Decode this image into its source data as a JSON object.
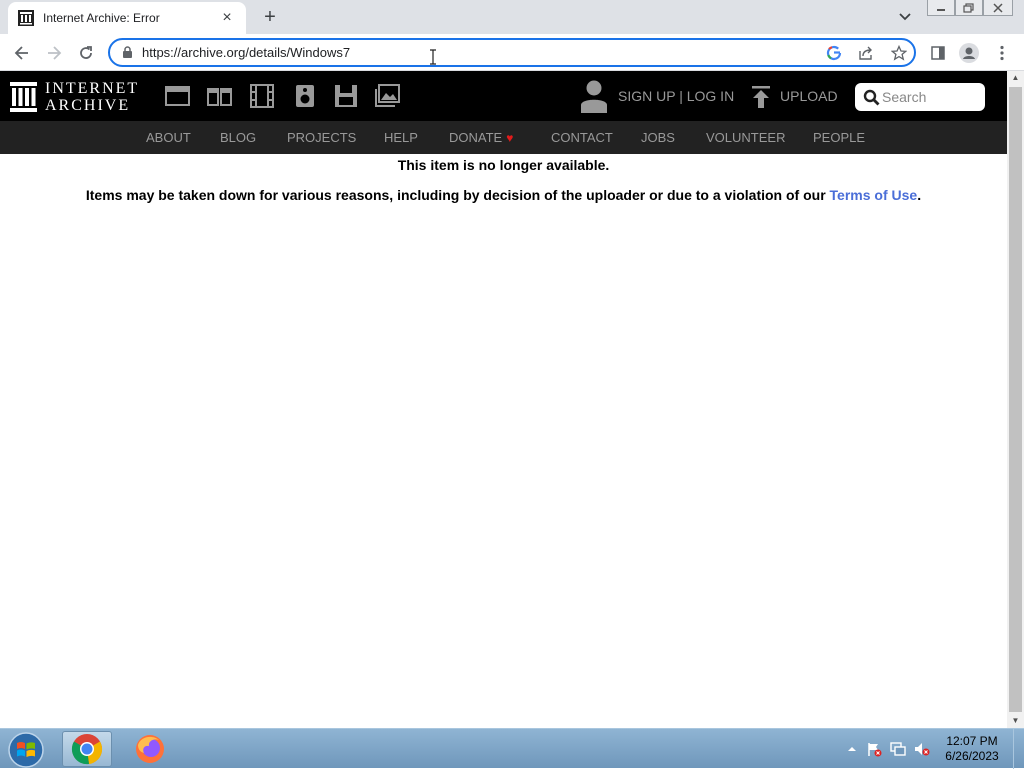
{
  "browser": {
    "tab_title": "Internet Archive: Error",
    "new_tab_symbol": "+",
    "close_symbol": "×",
    "url": "https://archive.org/details/Windows7"
  },
  "ia": {
    "logo_line1": "INTERNET",
    "logo_line2": "ARCHIVE",
    "media_icons": [
      "web-icon",
      "texts-icon",
      "video-icon",
      "audio-icon",
      "software-icon",
      "images-icon"
    ],
    "signup": "SIGN UP | LOG IN",
    "upload": "UPLOAD",
    "search_placeholder": "Search",
    "nav": [
      "ABOUT",
      "BLOG",
      "PROJECTS",
      "HELP",
      "DONATE",
      "CONTACT",
      "JOBS",
      "VOLUNTEER",
      "PEOPLE"
    ],
    "donate_heart": "♥"
  },
  "page": {
    "message_title": "This item is no longer available.",
    "message_body": "Items may be taken down for various reasons, including by decision of the uploader or due to a violation of our ",
    "terms_link": "Terms of Use",
    "message_end": "."
  },
  "taskbar": {
    "time": "12:07 PM",
    "date": "6/26/2023"
  },
  "colors": {
    "accent": "#1a73e8",
    "link": "#4a6ed8",
    "heart": "#e21b1b",
    "ia_header": "#000000",
    "ia_nav": "#222222"
  }
}
